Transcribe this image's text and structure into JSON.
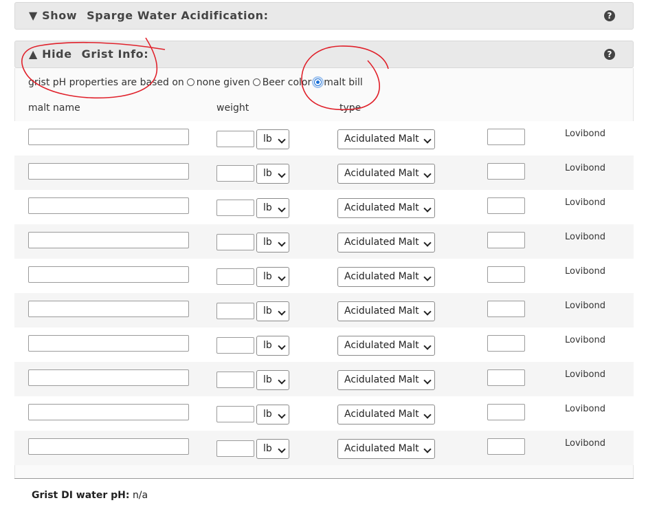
{
  "sparge_panel": {
    "toggle_label": "Show",
    "arrow": "▼",
    "title": "Sparge Water Acidification:",
    "help_icon": "?"
  },
  "grist_panel": {
    "toggle_label": "Hide",
    "arrow": "▲",
    "title": "Grist Info:",
    "help_icon": "?"
  },
  "basis": {
    "prompt": "grist pH properties are based on",
    "options": [
      {
        "label": "none given",
        "checked": false
      },
      {
        "label": "Beer color",
        "checked": false
      },
      {
        "label": "malt bill",
        "checked": true
      }
    ]
  },
  "columns": {
    "malt_name": "malt name",
    "weight": "weight",
    "type": "type"
  },
  "rows": [
    {
      "name": "",
      "weight": "",
      "unit": "lb",
      "type": "Acidulated Malt",
      "color": "",
      "color_unit": "Lovibond"
    },
    {
      "name": "",
      "weight": "",
      "unit": "lb",
      "type": "Acidulated Malt",
      "color": "",
      "color_unit": "Lovibond"
    },
    {
      "name": "",
      "weight": "",
      "unit": "lb",
      "type": "Acidulated Malt",
      "color": "",
      "color_unit": "Lovibond"
    },
    {
      "name": "",
      "weight": "",
      "unit": "lb",
      "type": "Acidulated Malt",
      "color": "",
      "color_unit": "Lovibond"
    },
    {
      "name": "",
      "weight": "",
      "unit": "lb",
      "type": "Acidulated Malt",
      "color": "",
      "color_unit": "Lovibond"
    },
    {
      "name": "",
      "weight": "",
      "unit": "lb",
      "type": "Acidulated Malt",
      "color": "",
      "color_unit": "Lovibond"
    },
    {
      "name": "",
      "weight": "",
      "unit": "lb",
      "type": "Acidulated Malt",
      "color": "",
      "color_unit": "Lovibond"
    },
    {
      "name": "",
      "weight": "",
      "unit": "lb",
      "type": "Acidulated Malt",
      "color": "",
      "color_unit": "Lovibond"
    },
    {
      "name": "",
      "weight": "",
      "unit": "lb",
      "type": "Acidulated Malt",
      "color": "",
      "color_unit": "Lovibond"
    },
    {
      "name": "",
      "weight": "",
      "unit": "lb",
      "type": "Acidulated Malt",
      "color": "",
      "color_unit": "Lovibond"
    }
  ],
  "summary": {
    "label": "Grist DI water pH:",
    "value": "n/a"
  },
  "colors": {
    "header_bg": "#e9e9e9",
    "annotation": "#e0202a",
    "radio_selected": "#1a6fd6"
  }
}
